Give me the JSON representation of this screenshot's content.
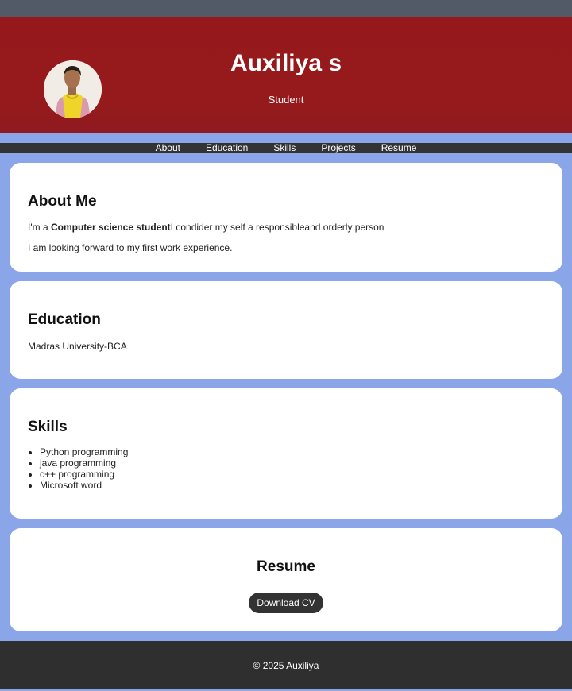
{
  "header": {
    "name": "Auxiliya s",
    "role": "Student"
  },
  "nav": {
    "items": [
      {
        "label": "About"
      },
      {
        "label": "Education"
      },
      {
        "label": "Skills"
      },
      {
        "label": "Projects"
      },
      {
        "label": "Resume"
      }
    ]
  },
  "about": {
    "title": "About Me",
    "line1_prefix": "I'm a ",
    "line1_bold": "Computer science student",
    "line1_suffix": "I condider my self a responsibleand orderly person",
    "line2": "I am looking forward to my first work experience."
  },
  "education": {
    "title": "Education",
    "detail": "Madras University-BCA"
  },
  "skills": {
    "title": "Skills",
    "items": [
      "Python programming",
      "java programming",
      "c++ programming",
      "Microsoft word"
    ]
  },
  "resume": {
    "title": "Resume",
    "button_label": "Download CV"
  },
  "footer": {
    "text": "© 2025 Auxiliya"
  },
  "colors": {
    "header_bg": "#95191c",
    "page_bg": "#8aa6e8",
    "nav_bg": "#333333",
    "footer_bg": "#2f2f2f",
    "topbar_bg": "#525a68"
  }
}
